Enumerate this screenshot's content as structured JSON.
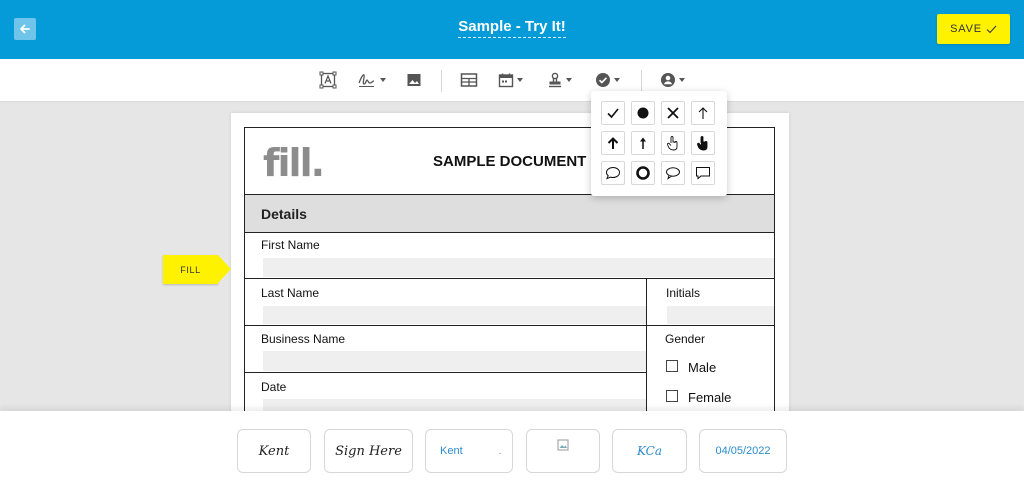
{
  "header": {
    "title": "Sample - Try It!",
    "save_label": "SAVE"
  },
  "document": {
    "logo": "fill.",
    "title": "SAMPLE DOCUMENT",
    "section": "Details",
    "fields": {
      "first_name": "First Name",
      "last_name": "Last Name",
      "initials": "Initials",
      "business_name": "Business Name",
      "gender": "Gender",
      "date": "Date"
    },
    "gender_options": [
      "Male",
      "Female"
    ]
  },
  "fill_tag": "FILL",
  "tray": {
    "signature_1": "Kent",
    "signature_2": "Sign Here",
    "text_value": "Kent",
    "text_dot": ".",
    "initials_value": "KCa",
    "date_value": "04/05/2022"
  },
  "colors": {
    "header": "#049bd8",
    "accent": "#fff200",
    "link": "#2b8ccc"
  }
}
